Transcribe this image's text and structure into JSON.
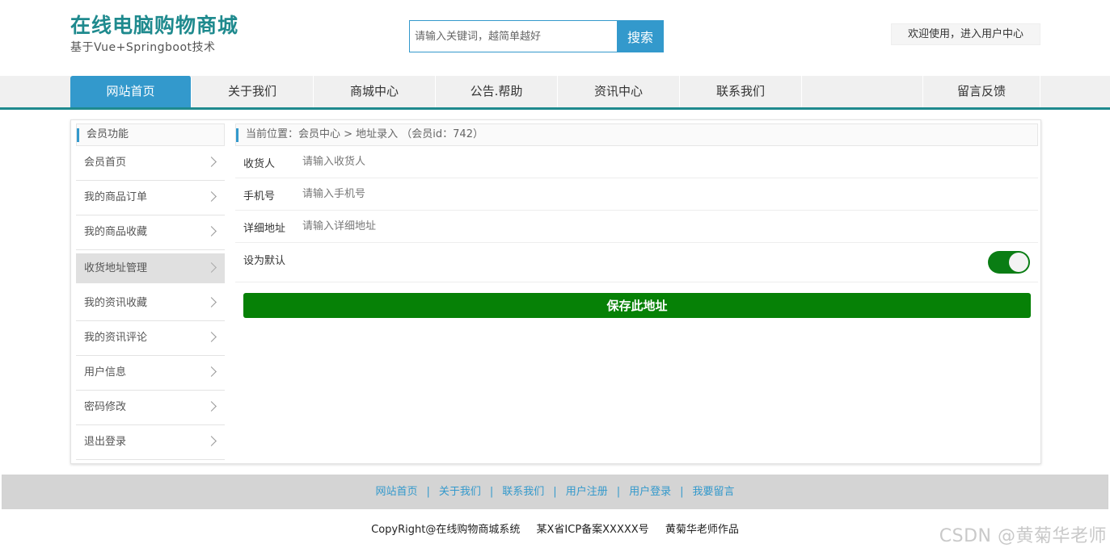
{
  "header": {
    "site_title": "在线电脑购物商城",
    "site_subtitle": "基于Vue+Springboot技术",
    "search_placeholder": "请输入关键词，越简单越好",
    "search_button": "搜索",
    "user_center": "欢迎使用，进入用户中心"
  },
  "nav": {
    "items": [
      "网站首页",
      "关于我们",
      "商城中心",
      "公告.帮助",
      "资讯中心",
      "联系我们"
    ],
    "last_item": "留言反馈"
  },
  "sidebar": {
    "title": "会员功能",
    "items": [
      "会员首页",
      "我的商品订单",
      "我的商品收藏",
      "收货地址管理",
      "我的资讯收藏",
      "我的资讯评论",
      "用户信息",
      "密码修改",
      "退出登录"
    ]
  },
  "breadcrumb": {
    "text": "当前位置：会员中心 > 地址录入 （会员id：742）"
  },
  "form": {
    "receiver_label": "收货人",
    "receiver_placeholder": "请输入收货人",
    "phone_label": "手机号",
    "phone_placeholder": "请输入手机号",
    "address_label": "详细地址",
    "address_placeholder": "请输入详细地址",
    "default_label": "设为默认",
    "default_on": true,
    "save_button": "保存此地址"
  },
  "footer": {
    "links": [
      "网站首页",
      "关于我们",
      "联系我们",
      "用户注册",
      "用户登录",
      "我要留言"
    ],
    "copyright": "CopyRight@在线购物商城系统",
    "icp": "某X省ICP备案XXXXX号",
    "author": "黄菊华老师作品"
  },
  "watermark": "CSDN @黄菊华老师",
  "colors": {
    "brand": "#1f8a8e",
    "accent": "#3399cc",
    "save": "#068106"
  }
}
